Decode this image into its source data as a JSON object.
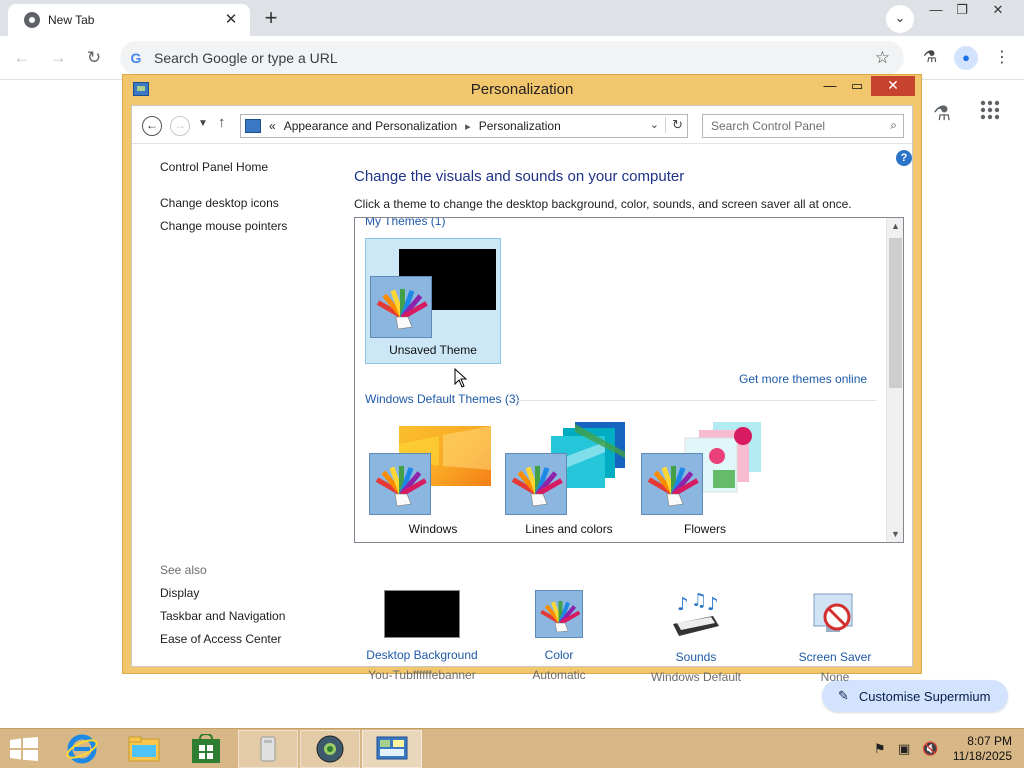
{
  "browser": {
    "tab_title": "New Tab",
    "omnibox_placeholder": "Search Google or type a URL",
    "customise_label": "Customise Supermium",
    "icons": [
      "chrome-icon",
      "close-icon",
      "new-tab-icon",
      "tab-search-icon",
      "back-icon",
      "forward-icon",
      "reload-icon",
      "star-icon",
      "labs-icon",
      "profile-icon",
      "menu-icon",
      "apps-grid-icon",
      "pencil-icon"
    ]
  },
  "window": {
    "title": "Personalization"
  },
  "navbar": {
    "breadcrumb_prefix": "«",
    "breadcrumb": [
      "Appearance and Personalization",
      "Personalization"
    ],
    "search_placeholder": "Search Control Panel"
  },
  "left_pane": {
    "home": "Control Panel Home",
    "links": [
      "Change desktop icons",
      "Change mouse pointers"
    ],
    "see_also_title": "See also",
    "see_also": [
      "Display",
      "Taskbar and Navigation",
      "Ease of Access Center"
    ]
  },
  "main": {
    "heading": "Change the visuals and sounds on your computer",
    "subtitle": "Click a theme to change the desktop background, color, sounds, and screen saver all at once.",
    "my_themes_title": "My Themes (1)",
    "my_themes": [
      {
        "label": "Unsaved Theme",
        "selected": true
      }
    ],
    "get_more": "Get more themes online",
    "default_themes_title": "Windows Default Themes (3)",
    "default_themes": [
      {
        "label": "Windows"
      },
      {
        "label": "Lines and colors"
      },
      {
        "label": "Flowers"
      }
    ]
  },
  "settings": [
    {
      "label": "Desktop Background",
      "value": "You-Tubffffffebanner"
    },
    {
      "label": "Color",
      "value": "Automatic"
    },
    {
      "label": "Sounds",
      "value": "Windows Default"
    },
    {
      "label": "Screen Saver",
      "value": "None"
    }
  ],
  "taskbar": {
    "time": "8:07 PM",
    "date": "11/18/2025"
  },
  "colors": {
    "window_frame": "#f2c66d",
    "close_button": "#c7422f",
    "link": "#1e5aa8",
    "heading": "#1e3287",
    "taskbar": "#d8b786",
    "selection": "#cce8f7"
  }
}
